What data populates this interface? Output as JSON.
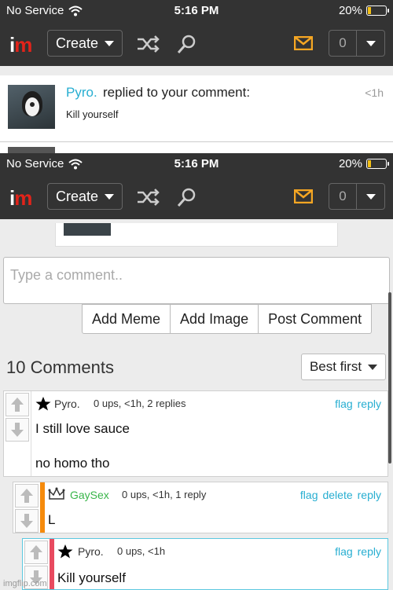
{
  "status": {
    "carrier": "No Service",
    "time": "5:16 PM",
    "battery": "20%",
    "battery_level": 0.2
  },
  "nav": {
    "logo_i": "i",
    "logo_m": "m",
    "create_label": "Create",
    "count": "0",
    "icons": [
      "shuffle-icon",
      "search-icon",
      "mail-icon"
    ]
  },
  "notification": {
    "user": "Pyro.",
    "text": "replied to your comment:",
    "time": "<1h",
    "body": "Kill yourself"
  },
  "compose": {
    "placeholder": "Type a comment..",
    "add_meme": "Add Meme",
    "add_image": "Add Image",
    "post_comment": "Post Comment"
  },
  "comments_header": {
    "count_label": "10 Comments",
    "sort_label": "Best first"
  },
  "comments": [
    {
      "user": "Pyro.",
      "meta": "0 ups, <1h, 2 replies",
      "line1": "I still love sauce",
      "line2": "no homo tho",
      "actions": [
        "flag",
        "reply"
      ],
      "accent": "#ffffff"
    },
    {
      "user": "GaySex",
      "meta": "0 ups, <1h, 1 reply",
      "line1": "L",
      "actions": [
        "flag",
        "delete",
        "reply"
      ],
      "accent": "#f58a0b",
      "user_color": "#39b54a"
    },
    {
      "user": "Pyro.",
      "meta": "0 ups, <1h",
      "line1": "Kill yourself",
      "actions": [
        "flag",
        "reply"
      ],
      "accent": "#e84a5f"
    }
  ],
  "colors": {
    "brand_red": "#e2231a",
    "link": "#27aed1",
    "nav_bg": "#333333",
    "mail": "#f5a623"
  },
  "watermark": "imgflip.com"
}
